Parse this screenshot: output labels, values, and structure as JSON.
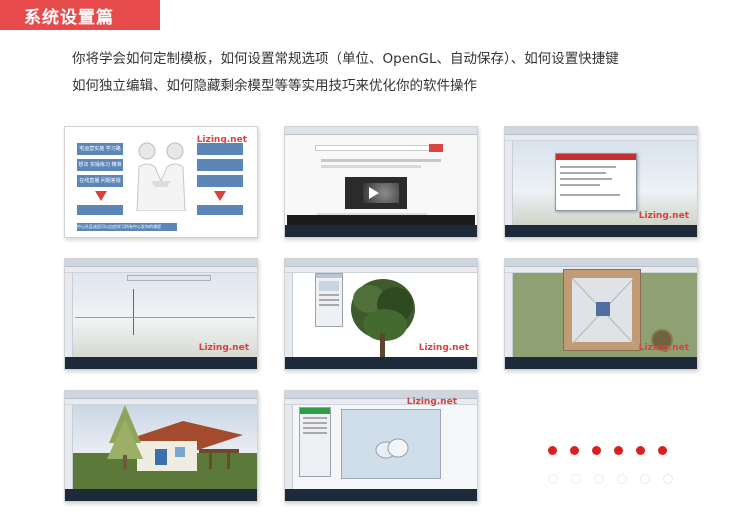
{
  "section": {
    "title": "系统设置篇"
  },
  "intro": {
    "line1": "你将学会如何定制模板，如何设置常规选项（单位、OpenGL、自动保存）、如何设置快捷键",
    "line2": "如何独立编辑、如何隐藏剩余模型等等实用技巧来优化你的软件操作"
  },
  "watermark": "Lizing.net",
  "slide": {
    "box1": "宅运营实施 学习路径规划",
    "box2": "想法   实操练习 精准方法",
    "box3": "在线直播 问题答疑",
    "bottom_note": "中心社区成员可以自由学习所有中心发布的课程"
  },
  "colors": {
    "accent": "#e64a4a",
    "dot": "#d8201f"
  },
  "pagination": {
    "filled_count": 6,
    "empty_count": 6
  }
}
